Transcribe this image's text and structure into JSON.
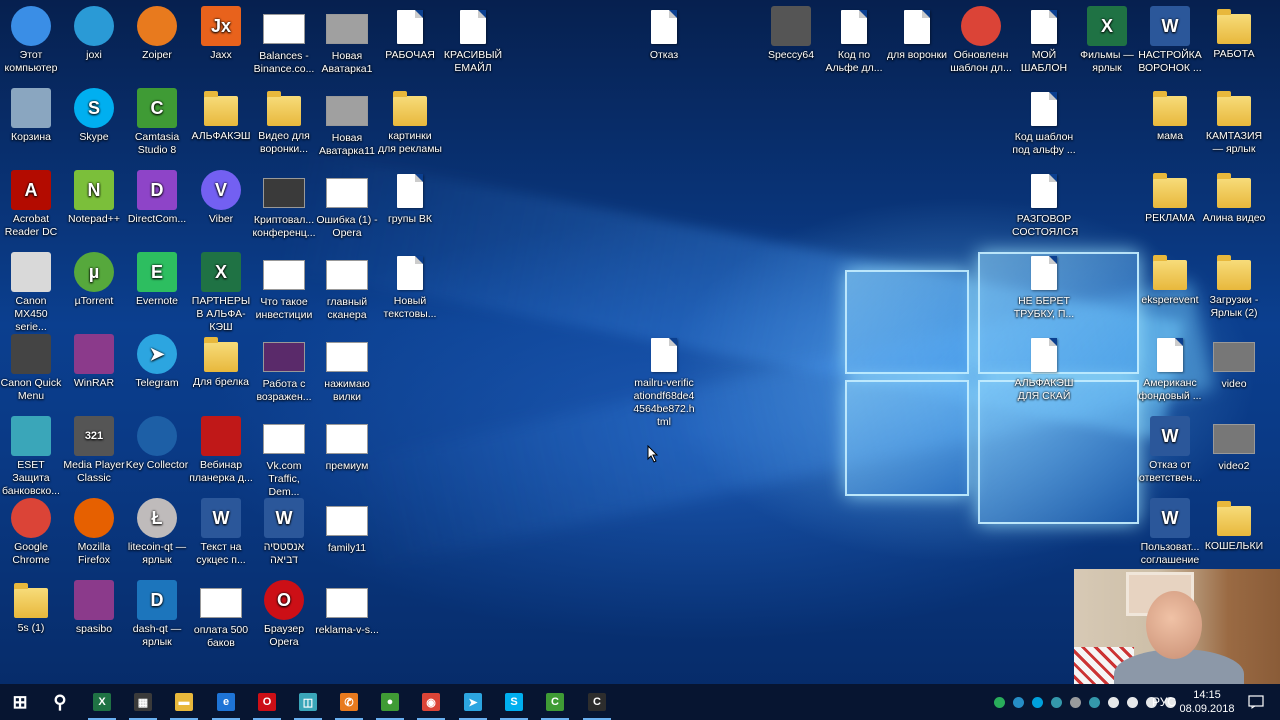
{
  "desktop_icons": [
    {
      "label": "Этот компьютер",
      "icon": "computer-icon",
      "kind": "round",
      "color": "#3a8ee6",
      "col": 0,
      "row": 0
    },
    {
      "label": "joxi",
      "icon": "joxi-bird-icon",
      "kind": "round",
      "color": "#2a9ad6",
      "col": 1,
      "row": 0
    },
    {
      "label": "Zoiper",
      "icon": "zoiper-icon",
      "kind": "round",
      "color": "#e87a1e",
      "col": 2,
      "row": 0
    },
    {
      "label": "Jaxx",
      "icon": "jaxx-icon",
      "kind": "box",
      "color": "#e8621c",
      "glyph": "Jx",
      "col": 3,
      "row": 0
    },
    {
      "label": "Balances - Binance.co...",
      "icon": "shortcut-icon",
      "kind": "thumb",
      "color": "#ffffff",
      "col": 4,
      "row": 0
    },
    {
      "label": "Новая Аватарка1",
      "icon": "image-thumbnail-icon",
      "kind": "thumb",
      "color": "#a0a0a0",
      "col": 5,
      "row": 0
    },
    {
      "label": "РАБОЧАЯ",
      "icon": "document-icon",
      "kind": "doc",
      "col": 6,
      "row": 0
    },
    {
      "label": "КРАСИВЫЙ ЕМАЙЛ",
      "icon": "document-icon",
      "kind": "doc",
      "col": 7,
      "row": 0
    },
    {
      "label": "Корзина",
      "icon": "recycle-bin-icon",
      "kind": "box",
      "color": "#8aa6c0",
      "col": 0,
      "row": 1
    },
    {
      "label": "Skype",
      "icon": "skype-icon",
      "kind": "round",
      "color": "#00aff0",
      "glyph": "S",
      "col": 1,
      "row": 1
    },
    {
      "label": "Camtasia Studio 8",
      "icon": "camtasia-icon",
      "kind": "box",
      "color": "#3f9b35",
      "glyph": "C",
      "col": 2,
      "row": 1
    },
    {
      "label": "АЛЬФАКЭШ",
      "icon": "folder-icon",
      "kind": "folder",
      "col": 3,
      "row": 1
    },
    {
      "label": "Видео для воронки...",
      "icon": "video-folder-icon",
      "kind": "folder",
      "col": 4,
      "row": 1
    },
    {
      "label": "Новая Аватарка11",
      "icon": "image-thumbnail-icon",
      "kind": "thumb",
      "color": "#a0a0a0",
      "col": 5,
      "row": 1
    },
    {
      "label": "картинки для рекламы",
      "icon": "folder-icon",
      "kind": "folder",
      "col": 6,
      "row": 1
    },
    {
      "label": "Acrobat Reader DC",
      "icon": "acrobat-icon",
      "kind": "box",
      "color": "#b30b00",
      "glyph": "A",
      "col": 0,
      "row": 2
    },
    {
      "label": "Notepad++",
      "icon": "notepad-plus-plus-icon",
      "kind": "box",
      "color": "#7bbf3a",
      "glyph": "N",
      "col": 1,
      "row": 2
    },
    {
      "label": "DirectCom...",
      "icon": "directcom-icon",
      "kind": "box",
      "color": "#8e44c8",
      "glyph": "D",
      "col": 2,
      "row": 2
    },
    {
      "label": "Viber",
      "icon": "viber-icon",
      "kind": "round",
      "color": "#7360f2",
      "glyph": "V",
      "col": 3,
      "row": 2
    },
    {
      "label": "Криптовал... конференц...",
      "icon": "image-thumbnail-icon",
      "kind": "thumb",
      "color": "#3a3a3a",
      "col": 4,
      "row": 2
    },
    {
      "label": "Ошибка (1) - Opera",
      "icon": "shortcut-icon",
      "kind": "thumb",
      "color": "#ffffff",
      "col": 5,
      "row": 2
    },
    {
      "label": "групы ВК",
      "icon": "document-icon",
      "kind": "doc",
      "col": 6,
      "row": 2
    },
    {
      "label": "Canon MX450 serie...",
      "icon": "canon-printer-icon",
      "kind": "box",
      "color": "#d9d9d9",
      "col": 0,
      "row": 3
    },
    {
      "label": "µTorrent",
      "icon": "utorrent-icon",
      "kind": "round",
      "color": "#56a83c",
      "glyph": "µ",
      "col": 1,
      "row": 3
    },
    {
      "label": "Evernote",
      "icon": "evernote-icon",
      "kind": "box",
      "color": "#2dbe60",
      "glyph": "E",
      "col": 2,
      "row": 3
    },
    {
      "label": "ПАРТНЕРЫ В АЛЬФА-КЭШ",
      "icon": "excel-file-icon",
      "kind": "box",
      "color": "#1f7244",
      "glyph": "X",
      "col": 3,
      "row": 3
    },
    {
      "label": "Что такое инвестиции",
      "icon": "image-thumbnail-icon",
      "kind": "thumb",
      "color": "#ffffff",
      "col": 4,
      "row": 3
    },
    {
      "label": "главный сканера",
      "icon": "image-thumbnail-icon",
      "kind": "thumb",
      "color": "#ffffff",
      "col": 5,
      "row": 3
    },
    {
      "label": "Новый текстовы...",
      "icon": "document-icon",
      "kind": "doc",
      "col": 6,
      "row": 3
    },
    {
      "label": "Canon Quick Menu",
      "icon": "canon-quick-menu-icon",
      "kind": "box",
      "color": "#444444",
      "col": 0,
      "row": 4
    },
    {
      "label": "WinRAR",
      "icon": "winrar-icon",
      "kind": "box",
      "color": "#8b3a8b",
      "col": 1,
      "row": 4
    },
    {
      "label": "Telegram",
      "icon": "telegram-icon",
      "kind": "round",
      "color": "#2ca5e0",
      "glyph": "➤",
      "col": 2,
      "row": 4
    },
    {
      "label": "Для брелка",
      "icon": "folder-icon",
      "kind": "folder",
      "col": 3,
      "row": 4
    },
    {
      "label": "Работа с возражен...",
      "icon": "image-thumbnail-icon",
      "kind": "thumb",
      "color": "#5a2a6a",
      "col": 4,
      "row": 4
    },
    {
      "label": "нажимаю вилки",
      "icon": "image-thumbnail-icon",
      "kind": "thumb",
      "color": "#ffffff",
      "col": 5,
      "row": 4
    },
    {
      "label": "ESET Защита банковско...",
      "icon": "eset-icon",
      "kind": "box",
      "color": "#3aa6b9",
      "col": 0,
      "row": 5
    },
    {
      "label": "Media Player Classic",
      "icon": "media-player-classic-icon",
      "kind": "box",
      "color": "#555555",
      "glyph": "321",
      "col": 1,
      "row": 5
    },
    {
      "label": "Key Collector",
      "icon": "key-collector-icon",
      "kind": "round",
      "color": "#1d5fa6",
      "col": 2,
      "row": 5
    },
    {
      "label": "Вебинар планерка д...",
      "icon": "video-file-icon",
      "kind": "box",
      "color": "#c01818",
      "col": 3,
      "row": 5
    },
    {
      "label": "Vk.com Traffic, Dem...",
      "icon": "image-thumbnail-icon",
      "kind": "thumb",
      "color": "#ffffff",
      "col": 4,
      "row": 5
    },
    {
      "label": "премиум",
      "icon": "image-thumbnail-icon",
      "kind": "thumb",
      "color": "#ffffff",
      "col": 5,
      "row": 5
    },
    {
      "label": "Google Chrome",
      "icon": "chrome-icon",
      "kind": "round",
      "color": "#db4437",
      "col": 0,
      "row": 6
    },
    {
      "label": "Mozilla Firefox",
      "icon": "firefox-icon",
      "kind": "round",
      "color": "#e66000",
      "col": 1,
      "row": 6
    },
    {
      "label": "litecoin-qt — ярлык",
      "icon": "litecoin-icon",
      "kind": "round",
      "color": "#bfbbbb",
      "glyph": "Ł",
      "col": 2,
      "row": 6
    },
    {
      "label": "Текст на сукцес п...",
      "icon": "word-file-icon",
      "kind": "box",
      "color": "#2b579a",
      "glyph": "W",
      "col": 3,
      "row": 6
    },
    {
      "label": "אנסטסיה דביאה",
      "icon": "word-file-icon",
      "kind": "box",
      "color": "#2b579a",
      "glyph": "W",
      "col": 4,
      "row": 6
    },
    {
      "label": "family11",
      "icon": "image-thumbnail-icon",
      "kind": "thumb",
      "color": "#ffffff",
      "col": 5,
      "row": 6
    },
    {
      "label": "5s (1)",
      "icon": "folder-icon",
      "kind": "folder",
      "col": 0,
      "row": 7
    },
    {
      "label": "spasibo",
      "icon": "winrar-icon",
      "kind": "box",
      "color": "#8b3a8b",
      "col": 1,
      "row": 7
    },
    {
      "label": "dash-qt — ярлык",
      "icon": "dash-icon",
      "kind": "box",
      "color": "#1c75bc",
      "glyph": "D",
      "col": 2,
      "row": 7
    },
    {
      "label": "оплата 500 баков",
      "icon": "shortcut-icon",
      "kind": "thumb",
      "color": "#ffffff",
      "col": 3,
      "row": 7
    },
    {
      "label": "Браузер Opera",
      "icon": "opera-icon",
      "kind": "round",
      "color": "#cc0f16",
      "glyph": "O",
      "col": 4,
      "row": 7
    },
    {
      "label": "reklama-v-s...",
      "icon": "image-thumbnail-icon",
      "kind": "thumb",
      "color": "#ffffff",
      "col": 5,
      "row": 7
    }
  ],
  "right_icons": [
    {
      "label": "Отказ",
      "icon": "document-icon",
      "kind": "doc",
      "slot": "otkaz"
    },
    {
      "label": "Speccy64",
      "icon": "speccy-icon",
      "kind": "box",
      "color": "#555555",
      "slot": "speccy"
    },
    {
      "label": "Код по Альфе дл...",
      "icon": "document-icon",
      "kind": "doc",
      "slot": "kod"
    },
    {
      "label": "для воронки",
      "icon": "document-icon",
      "kind": "doc",
      "slot": "dlya-voronki"
    },
    {
      "label": "Обновленн шаблон дл...",
      "icon": "chrome-icon",
      "kind": "round",
      "color": "#db4437",
      "slot": "obnovlen"
    },
    {
      "label": "МОЙ ШАБЛОН",
      "icon": "document-icon",
      "kind": "doc",
      "slot": "moy"
    },
    {
      "label": "Фильмы — ярлык",
      "icon": "excel-file-icon",
      "kind": "box",
      "color": "#1f7244",
      "glyph": "X",
      "slot": "filmy"
    },
    {
      "label": "НАСТРОЙКА ВОРОНОК ...",
      "icon": "word-file-icon",
      "kind": "box",
      "color": "#2b579a",
      "glyph": "W",
      "slot": "nastroyka"
    },
    {
      "label": "РАБОТА",
      "icon": "folder-icon",
      "kind": "folder",
      "slot": "rabota"
    },
    {
      "label": "Код шаблон под альфу ...",
      "icon": "document-icon",
      "kind": "doc",
      "slot": "kod-shablon"
    },
    {
      "label": "мама",
      "icon": "folder-icon",
      "kind": "folder",
      "slot": "mama"
    },
    {
      "label": "КАМТАЗИЯ — ярлык",
      "icon": "folder-icon",
      "kind": "folder",
      "slot": "kamtaziya"
    },
    {
      "label": "РАЗГОВОР СОСТОЯЛСЯ",
      "icon": "document-icon",
      "kind": "doc",
      "slot": "razgovor"
    },
    {
      "label": "РЕКЛАМА",
      "icon": "folder-icon",
      "kind": "folder",
      "slot": "reklama"
    },
    {
      "label": "Алина видео",
      "icon": "folder-icon",
      "kind": "folder",
      "slot": "alina"
    },
    {
      "label": "НЕ БЕРЕТ ТРУБКУ, П...",
      "icon": "document-icon",
      "kind": "doc",
      "slot": "ne-beret"
    },
    {
      "label": "eksperevent",
      "icon": "folder-icon",
      "kind": "folder",
      "slot": "eksperevent"
    },
    {
      "label": "Загрузки - Ярлык (2)",
      "icon": "downloads-folder-icon",
      "kind": "folder",
      "slot": "zagruzki"
    },
    {
      "label": "mailru-verificationdf68de44564be872.html",
      "icon": "html-file-icon",
      "kind": "doc",
      "slot": "mailru"
    },
    {
      "label": "АЛЬФАКЭШ ДЛЯ СКАЙ",
      "icon": "document-icon",
      "kind": "doc",
      "slot": "alfa-skay"
    },
    {
      "label": "Американс фондовый ...",
      "icon": "pdf-file-icon",
      "kind": "doc",
      "slot": "amerikans"
    },
    {
      "label": "video",
      "icon": "video-thumbnail-icon",
      "kind": "thumb",
      "color": "#777777",
      "slot": "video"
    },
    {
      "label": "Отказ от ответствен...",
      "icon": "word-file-icon",
      "kind": "box",
      "color": "#2b579a",
      "glyph": "W",
      "slot": "otkaz-otv"
    },
    {
      "label": "video2",
      "icon": "video-thumbnail-icon",
      "kind": "thumb",
      "color": "#777777",
      "slot": "video2"
    },
    {
      "label": "Пользоват... соглашение",
      "icon": "word-file-icon",
      "kind": "box",
      "color": "#2b579a",
      "glyph": "W",
      "slot": "polzovat"
    },
    {
      "label": "КОШЕЛЬКИ",
      "icon": "folder-icon",
      "kind": "folder",
      "slot": "koshelki"
    }
  ],
  "taskbar": {
    "items": [
      {
        "name": "start-button-icon",
        "glyph": "⊞",
        "color": "transparent"
      },
      {
        "name": "search-icon",
        "glyph": "⚲",
        "color": "transparent"
      },
      {
        "name": "excel-taskbar-icon",
        "glyph": "X",
        "color": "#1f7244"
      },
      {
        "name": "calculator-taskbar-icon",
        "glyph": "▦",
        "color": "#3a3a3a"
      },
      {
        "name": "file-explorer-taskbar-icon",
        "glyph": "▬",
        "color": "#e8b83c"
      },
      {
        "name": "edge-taskbar-icon",
        "glyph": "e",
        "color": "#1e74d6"
      },
      {
        "name": "opera-taskbar-icon",
        "glyph": "O",
        "color": "#cc0f16"
      },
      {
        "name": "app-taskbar-icon",
        "glyph": "◫",
        "color": "#3aa6b9"
      },
      {
        "name": "zoiper-taskbar-icon",
        "glyph": "✆",
        "color": "#e87a1e"
      },
      {
        "name": "camtasia-recorder-taskbar-icon",
        "glyph": "●",
        "color": "#3f9b35"
      },
      {
        "name": "chrome-taskbar-icon",
        "glyph": "◉",
        "color": "#db4437"
      },
      {
        "name": "telegram-taskbar-icon",
        "glyph": "➤",
        "color": "#2ca5e0"
      },
      {
        "name": "skype-taskbar-icon",
        "glyph": "S",
        "color": "#00aff0"
      },
      {
        "name": "camtasia-taskbar-icon",
        "glyph": "C",
        "color": "#3f9b35"
      },
      {
        "name": "camtasia-editor-taskbar-icon",
        "glyph": "C",
        "color": "#2d2d2d"
      }
    ],
    "tray_icons": [
      "evernote-tray-icon",
      "joxi-tray-icon",
      "skype-tray-icon",
      "eset-tray-icon",
      "network-tray-icon",
      "tray-app-icon",
      "wifi-tray-icon",
      "chat-tray-icon",
      "shield-tray-icon",
      "volume-icon"
    ],
    "language": "РУС",
    "time": "14:15",
    "date": "08.09.2018"
  }
}
